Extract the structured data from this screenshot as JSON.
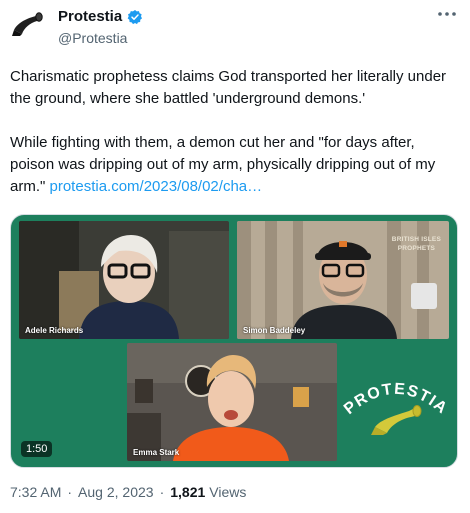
{
  "account": {
    "display_name": "Protestia",
    "handle": "@Protestia",
    "verified_icon": "verified-badge-icon",
    "avatar_icon": "shofar-logo-icon"
  },
  "more_icon": "more-options-icon",
  "tweet": {
    "paragraph1": "Charismatic prophetess claims God transported her literally under the ground, where she battled 'underground demons.'",
    "paragraph2": "While fighting with them, a demon cut her and \"for days after, poison was dripping out of my arm, physically dripping out of my arm.\" ",
    "link_text": "protestia.com/2023/08/02/cha…"
  },
  "media": {
    "duration": "1:50",
    "participants": [
      {
        "name": "Adele Richards"
      },
      {
        "name": "Simon Baddeley"
      },
      {
        "name": "Emma Stark"
      }
    ],
    "watermark_line1": "BRITISH ISLES",
    "watermark_line2": "PROPHETS",
    "brand_text": "PROTESTIA"
  },
  "meta": {
    "time": "7:32 AM",
    "date": "Aug 2, 2023",
    "views_count": "1,821",
    "views_label": "Views"
  },
  "colors": {
    "link": "#1d9bf0",
    "media_bg": "#1d7f5d",
    "brand_accent": "#d4c93a",
    "secondary_text": "#536471"
  }
}
